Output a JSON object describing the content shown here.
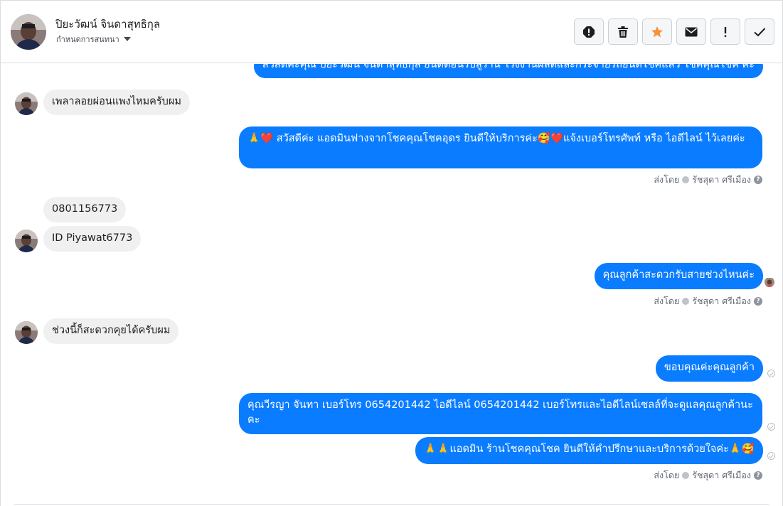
{
  "header": {
    "name": "ปิยะวัฒน์ จินดาสุทธิกุล",
    "assign_label": "กำหนดการสนทนา",
    "actions": [
      "spam-icon",
      "trash-icon",
      "star-icon",
      "mail-icon",
      "important-icon",
      "done-icon"
    ],
    "star_color": "#f7923b"
  },
  "messages": {
    "top_cut": "สวัสดีค่ะคุณ ปิยะวัฒน์ จินดาสุทธิกุล ยินดีต้อนรับสู่ร้าน โรงงานผลิตและกระจายรถยนต์โชคแล้ว โชคคุณโชค ค่ะ",
    "in_1": "เพลาลอยผ่อนแพงไหมครับผม",
    "out_1": "🙏❤️ สวัสดีค่ะ แอดมินฟางจากโชคคุณโชคอุดร ยินดีให้บริการค่ะ🥰❤️แจ้งเบอร์โทรศัพท์ หรือ ไอดีไลน์  ไว้เลยค่ะ",
    "in_2": "0801156773",
    "in_3": "ID   Piyawat6773",
    "out_2": "คุณลูกค้าสะดวกรับสายช่วงไหนค่ะ",
    "in_4": "ช่วงนี้ก็สะดวกคุยได้ครับผม",
    "out_3": "ขอบคุณค่ะคุณลูกค้า",
    "out_4": "คุณวีรญา จันทา      เบอร์โทร 0654201442  ไอดีไลน์ 0654201442     เบอร์โทรและไอดีไลน์เซลล์ที่จะดูแลคุณลูกค้านะคะ",
    "out_5": "🙏🙏แอดมิน ร้านโชคคุณโชค ยินดีให้คำปรึกษาและบริการด้วยใจค่ะ🙏🥰"
  },
  "sent_by": {
    "prefix": "ส่งโดย",
    "agent": "รัชสุดา ศรีเมือง",
    "help": "?"
  },
  "colors": {
    "outgoing_bubble": "#0a7cff",
    "incoming_bubble": "#f0f0f0"
  }
}
